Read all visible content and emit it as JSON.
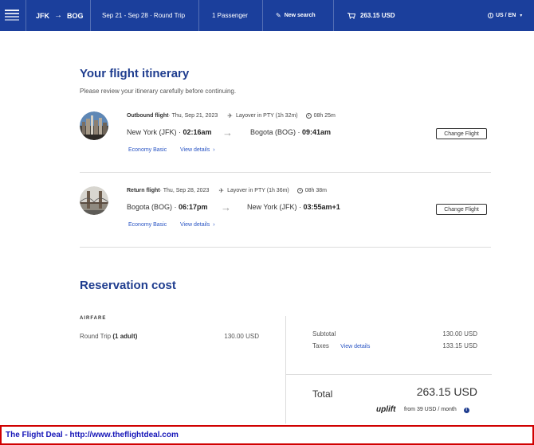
{
  "header": {
    "origin": "JFK",
    "destination": "BOG",
    "dates": "Sep 21 - Sep 28 · Round Trip",
    "passengers": "1 Passenger",
    "new_search": "New search",
    "price": "263.15 USD",
    "language": "US / EN",
    "brand_color": "#1b3f9c"
  },
  "page": {
    "title": "Your flight itinerary",
    "subtitle": "Please review your itinerary carefully before continuing."
  },
  "outbound": {
    "label": "Outbound flight",
    "date": " · Thu, Sep 21, 2023",
    "layover": "Layover in PTY (1h 32m)",
    "duration": "08h 25m",
    "from_city": "New York (JFK) · ",
    "from_time": "02:16am",
    "to_city": "Bogota (BOG) · ",
    "to_time": "09:41am",
    "fare_class": "Economy Basic",
    "view_details": "View details",
    "change_button": "Change Flight"
  },
  "return": {
    "label": "Return flight",
    "date": " · Thu, Sep 28, 2023",
    "layover": "Layover in PTY (1h 36m)",
    "duration": "08h 38m",
    "from_city": "Bogota (BOG) · ",
    "from_time": "06:17pm",
    "to_city": "New York (JFK) · ",
    "to_time": "03:55am+1",
    "fare_class": "Economy Basic",
    "view_details": "View details",
    "change_button": "Change Flight"
  },
  "cost": {
    "title": "Reservation cost",
    "airfare_heading": "AIRFARE",
    "airfare_label": "Round Trip ",
    "airfare_qualifier": "(1 adult)",
    "airfare_amount": "130.00 USD",
    "subtotal_label": "Subtotal",
    "subtotal_amount": "130.00 USD",
    "taxes_label": "Taxes",
    "taxes_view_details": "View details",
    "taxes_amount": "133.15 USD",
    "total_label": "Total",
    "total_amount": "263.15 USD",
    "uplift_logo": "uplift",
    "monthly": "from 39 USD  / month"
  },
  "banner": {
    "text": "The Flight Deal - http://www.theflightdeal.com",
    "border_color": "#d00000"
  },
  "icons": {
    "logo": "airline-logo-icon",
    "arrow": "arrow-right-icon",
    "pencil": "pencil-icon",
    "cart": "cart-icon",
    "info": "info-icon",
    "plane": "plane-icon",
    "clock": "clock-icon",
    "chevron": "chevron-right-icon"
  }
}
